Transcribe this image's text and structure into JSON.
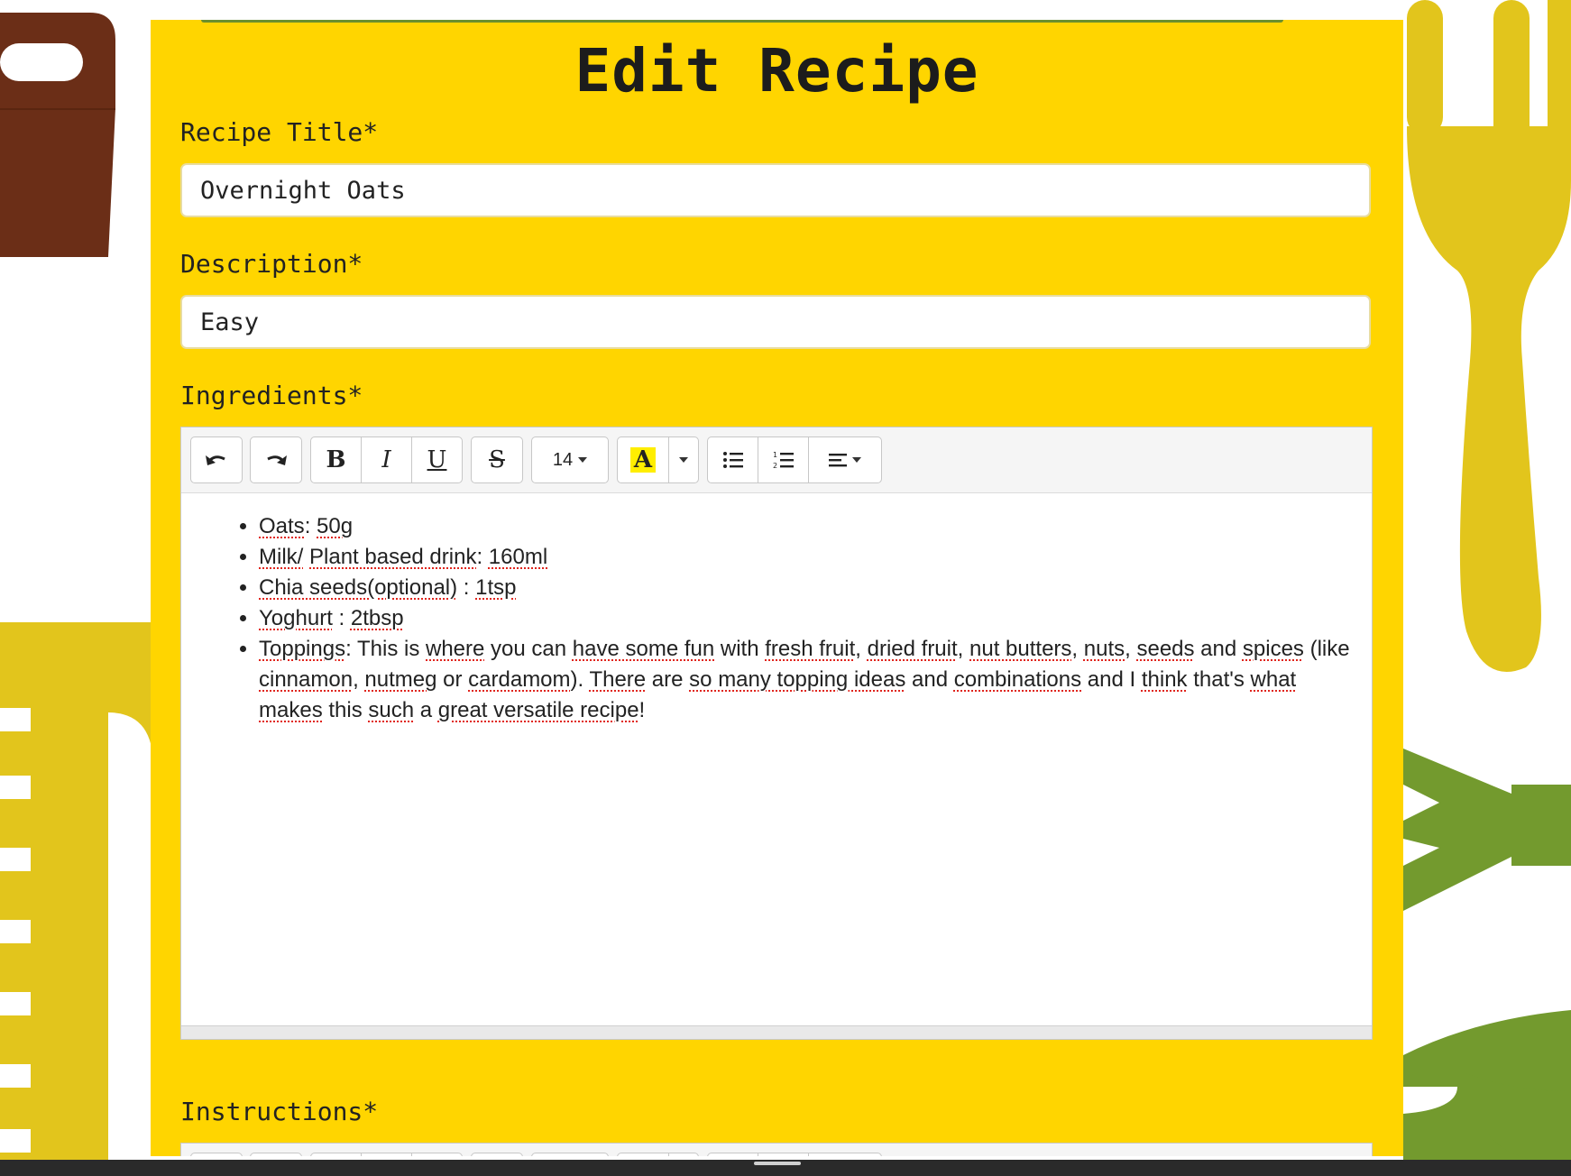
{
  "page": {
    "title": "Edit Recipe",
    "background_colors": {
      "panel": "#ffd500",
      "mustard": "#e2c51c",
      "brown": "#6b2e17",
      "green": "#739a2e"
    }
  },
  "form": {
    "title_label": "Recipe Title*",
    "title_value": "Overnight Oats",
    "description_label": "Description*",
    "description_value": "Easy",
    "ingredients_label": "Ingredients*",
    "instructions_label": "Instructions*"
  },
  "toolbar": {
    "undo_icon": "undo-icon",
    "redo_icon": "redo-icon",
    "bold": "B",
    "italic": "I",
    "underline": "U",
    "strikethrough": "S",
    "font_size": "14",
    "highlight": "A",
    "highlight_color": "#ffee00",
    "unordered_list_icon": "unordered-list-icon",
    "ordered_list_icon": "ordered-list-icon",
    "align_icon": "align-left-icon"
  },
  "ingredients": {
    "items": [
      [
        "Oats",
        ": ",
        "50g"
      ],
      [
        "Milk/",
        " ",
        "Plant based drink",
        ": ",
        "160ml"
      ],
      [
        "Chia seeds(optional)",
        " : ",
        "1tsp"
      ],
      [
        "Yoghurt",
        " : ",
        "2tbsp"
      ]
    ],
    "toppings": {
      "lead": "Toppings",
      "line1_a": ": This is ",
      "where": "where",
      "line1_b": " you can ",
      "have_some_fun": "have some fun",
      "line1_c": " with ",
      "fresh_fruit": "fresh fruit",
      "sep1": ", ",
      "dried_fruit": "dried fruit",
      "sep2": ", ",
      "nut_butters": "nut butters",
      "sep3": ", ",
      "nuts": "nuts",
      "sep4": ", ",
      "seeds": "seeds",
      "and1": " and ",
      "spices": "spices",
      "paren": " (like ",
      "cinnamon": "cinnamon",
      "sep5": ", ",
      "nutmeg": "nutmeg",
      "or": " or ",
      "cardamom": "cardamom",
      "close": "). ",
      "there": "There",
      "are": " are ",
      "so_many_topping_ideas": "so many topping ideas",
      "and2": " and ",
      "combinations": "combinations",
      "and_i": " and I ",
      "think": "think",
      "thats": " that's ",
      "what": "what",
      "makes": "makes",
      "this": " this ",
      "such": "such",
      "a": " a ",
      "great_versatile_recipe": "great versatile recipe",
      "end": "!"
    }
  }
}
